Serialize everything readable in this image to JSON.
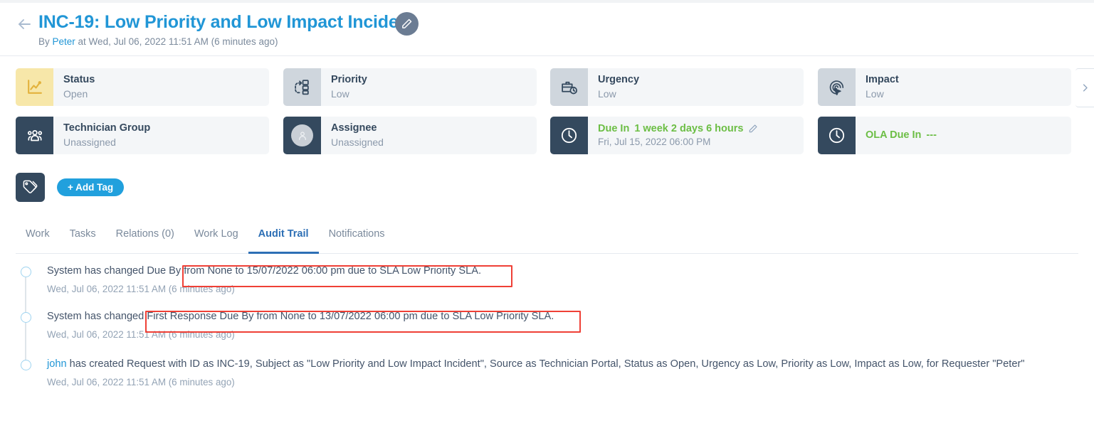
{
  "header": {
    "back_icon": "arrow-left-icon",
    "title": "INC-19: Low Priority and Low Impact Incident",
    "edit_icon": "pencil-icon",
    "byline_prefix": "By ",
    "byline_author": "Peter",
    "byline_suffix": " at Wed, Jul 06, 2022 11:51 AM (6 minutes ago)"
  },
  "cards": [
    {
      "label": "Status",
      "value": "Open",
      "icon": "chart-line-icon",
      "icon_style": "yellow"
    },
    {
      "label": "Priority",
      "value": "Low",
      "icon": "priority-flow-icon",
      "icon_style": "grey"
    },
    {
      "label": "Urgency",
      "value": "Low",
      "icon": "briefcase-clock-icon",
      "icon_style": "grey"
    },
    {
      "label": "Impact",
      "value": "Low",
      "icon": "fingerprint-cursor-icon",
      "icon_style": "grey"
    },
    {
      "label": "Technician Group",
      "value": "Unassigned",
      "icon": "users-group-icon",
      "icon_style": "dark"
    },
    {
      "label": "Assignee",
      "value": "Unassigned",
      "icon": "user-avatar-icon",
      "icon_style": "dark"
    }
  ],
  "due_card": {
    "label": "Due In",
    "value": "1 week 2 days 6 hours",
    "sub": "Fri, Jul 15, 2022 06:00 PM",
    "icon": "clock-icon",
    "edit_icon": "pencil-icon",
    "accent": "#6cbe45"
  },
  "ola_card": {
    "label": "OLA Due In",
    "value": "---",
    "icon": "clock-icon",
    "accent": "#6cbe45"
  },
  "scroll_next_icon": "chevron-right-icon",
  "tagrow": {
    "tag_icon": "tags-icon",
    "add_tag_label": "+ Add Tag"
  },
  "tabs": [
    {
      "label": "Work",
      "active": false
    },
    {
      "label": "Tasks",
      "active": false
    },
    {
      "label": "Relations (0)",
      "active": false
    },
    {
      "label": "Work Log",
      "active": false
    },
    {
      "label": "Audit Trail",
      "active": true
    },
    {
      "label": "Notifications",
      "active": false
    }
  ],
  "audit_entries": [
    {
      "text_plain": "System has changed Due By from None to 15/07/2022 06:00 pm due to SLA Low Priority SLA.",
      "time": "Wed, Jul 06, 2022 11:51 AM (6 minutes ago)"
    },
    {
      "text_plain": "System has changed First Response Due By from None to 13/07/2022 06:00 pm due to SLA Low Priority SLA.",
      "time": "Wed, Jul 06, 2022 11:51 AM (6 minutes ago)"
    },
    {
      "actor": "john",
      "text_plain": " has created Request with ID as INC-19, Subject as \"Low Priority and Low Impact Incident\", Source as Technician Portal, Status as Open, Urgency as Low, Priority as Low, Impact as Low, for Requester \"Peter\"",
      "time": "Wed, Jul 06, 2022 11:51 AM (6 minutes ago)"
    }
  ],
  "highlights": [
    {
      "name": "highlight-due-by",
      "color": "#ef4036"
    },
    {
      "name": "highlight-first-response",
      "color": "#ef4036"
    }
  ]
}
